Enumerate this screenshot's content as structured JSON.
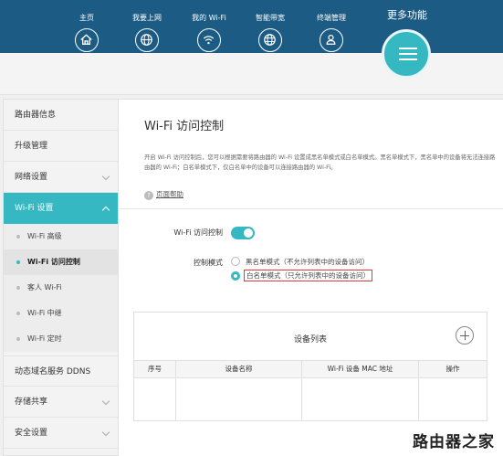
{
  "nav": {
    "items": [
      {
        "label": "主页",
        "icon": "home-icon"
      },
      {
        "label": "我要上网",
        "icon": "globe-icon"
      },
      {
        "label": "我的 Wi-Fi",
        "icon": "wifi-icon"
      },
      {
        "label": "智能带宽",
        "icon": "bandwidth-globe-icon"
      },
      {
        "label": "终端管理",
        "icon": "user-icon"
      }
    ],
    "more_label": "更多功能",
    "more_icon": "menu-icon"
  },
  "sidebar": {
    "items": [
      {
        "label": "路由器信息"
      },
      {
        "label": "升级管理"
      },
      {
        "label": "网络设置"
      },
      {
        "label": "Wi-Fi 设置",
        "active": true
      },
      {
        "label": "动态域名服务 DDNS"
      },
      {
        "label": "存储共享"
      },
      {
        "label": "安全设置"
      }
    ],
    "wifi_sub": [
      {
        "label": "Wi-Fi 高级"
      },
      {
        "label": "Wi-Fi 访问控制",
        "selected": true
      },
      {
        "label": "客人 Wi-Fi"
      },
      {
        "label": "Wi-Fi 中继"
      },
      {
        "label": "Wi-Fi 定时"
      }
    ]
  },
  "main": {
    "title": "Wi-Fi 访问控制",
    "description": "开启 Wi-Fi 访问控制后，您可以根据需要将路由器的 Wi-Fi 设置成黑名单模式或白名单模式。黑名单模式下，黑名单中的设备将无法连接路由器的 Wi-Fi；白名单模式下，仅白名单中的设备可以连接路由器的 Wi-Fi。",
    "help_label": "页面帮助",
    "toggle_label": "Wi-Fi 访问控制",
    "toggle_on": true,
    "mode_label": "控制模式",
    "modes": [
      {
        "label": "黑名单模式（不允许列表中的设备访问）",
        "checked": false
      },
      {
        "label": "白名单模式（只允许列表中的设备访问）",
        "checked": true
      }
    ],
    "device_list": {
      "title": "设备列表",
      "columns": [
        "序号",
        "设备名称",
        "Wi-Fi 设备 MAC 地址",
        "操作"
      ]
    }
  },
  "watermark": "路由器之家",
  "colors": {
    "nav_bg": "#1c5b84",
    "accent": "#35b8c1",
    "highlight_border": "#e23a3a"
  }
}
